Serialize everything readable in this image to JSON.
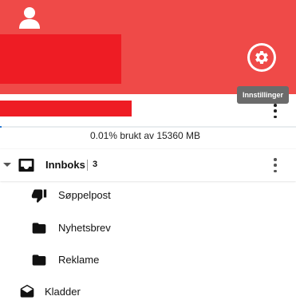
{
  "header": {
    "settings_tooltip": "Innstillinger"
  },
  "storage": {
    "text": "0.01% brukt av 15360 MB",
    "percent_used": 0.01
  },
  "inbox": {
    "label": "Innboks",
    "count": "3"
  },
  "folders": [
    {
      "label": "Søppelpost",
      "icon": "thumbs-down-icon"
    },
    {
      "label": "Nyhetsbrev",
      "icon": "folder-icon"
    },
    {
      "label": "Reklame",
      "icon": "folder-icon"
    }
  ],
  "drafts": {
    "label": "Kladder",
    "icon": "open-envelope-icon"
  },
  "colors": {
    "header_bg": "#ef4a48",
    "redaction": "#ee1c24",
    "tooltip_bg": "#6b6b6b",
    "progress_fill": "#2b7bd6"
  }
}
